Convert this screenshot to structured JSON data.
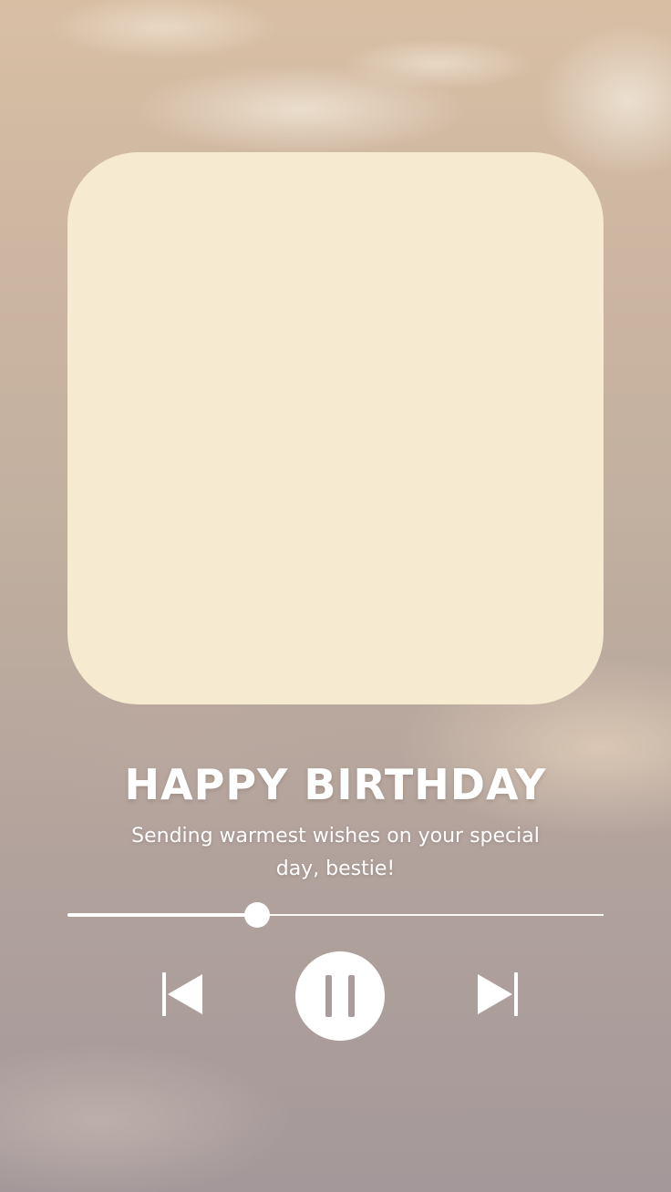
{
  "player": {
    "title": "HAPPY BIRTHDAY",
    "subtitle": "Sending warmest wishes on your special day, bestie!",
    "progress_fraction": 0.354,
    "controls": {
      "previous_icon": "skip-previous-icon",
      "pause_icon": "pause-icon",
      "next_icon": "skip-next-icon"
    }
  },
  "colors": {
    "album_art": "#f6ead0",
    "foreground": "#ffffff"
  }
}
